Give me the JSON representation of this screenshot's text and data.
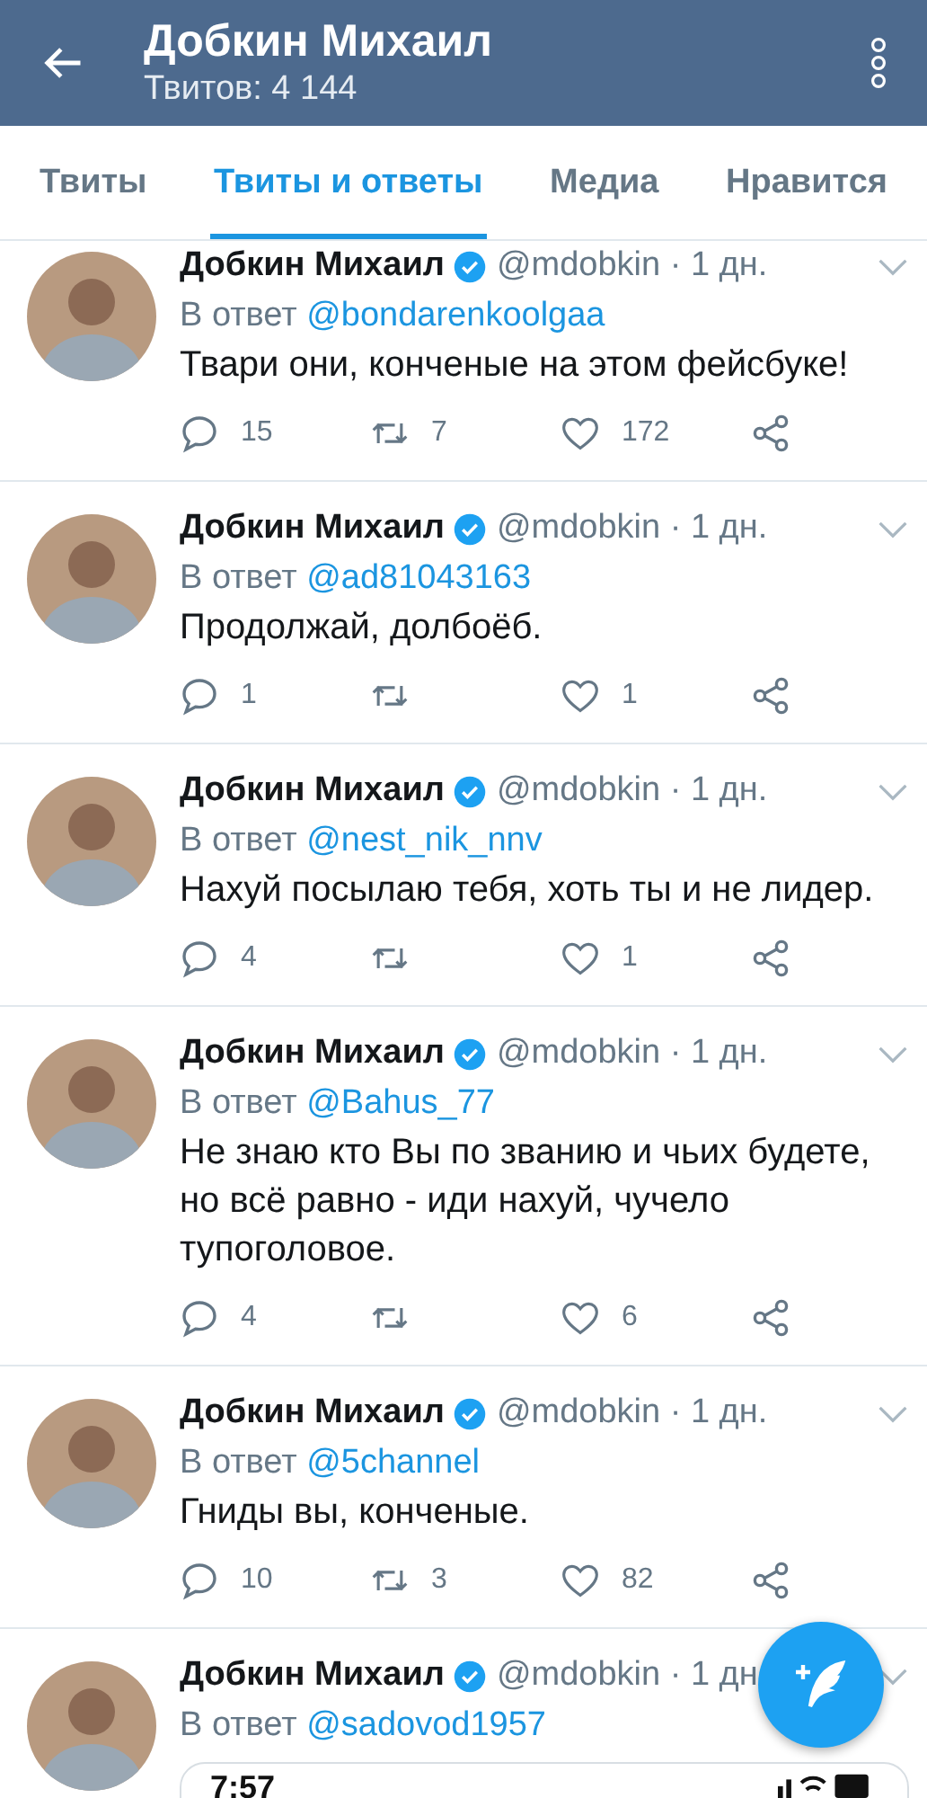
{
  "header": {
    "title": "Добкин Михаил",
    "subtitle": "Твитов: 4 144"
  },
  "tabs": [
    {
      "label": "Твиты",
      "selected": false
    },
    {
      "label": "Твиты и ответы",
      "selected": true
    },
    {
      "label": "Медиа",
      "selected": false
    },
    {
      "label": "Нравится",
      "selected": false
    }
  ],
  "tweets": [
    {
      "name": "Добкин Михаил",
      "verified": true,
      "handle": "@mdobkin · 1 дн.",
      "reply_prefix": "В ответ",
      "reply_to": "@bondarenkoolgaa",
      "text": "Твари они, конченые на этом фейсбуке!",
      "replies": "15",
      "retweets": "7",
      "likes": "172"
    },
    {
      "name": "Добкин Михаил",
      "verified": true,
      "handle": "@mdobkin · 1 дн.",
      "reply_prefix": "В ответ",
      "reply_to": "@ad81043163",
      "text": "Продолжай, долбоёб.",
      "replies": "1",
      "likes": "1"
    },
    {
      "name": "Добкин Михаил",
      "verified": true,
      "handle": "@mdobkin · 1 дн.",
      "reply_prefix": "В ответ",
      "reply_to": "@nest_nik_nnv",
      "text": "Нахуй посылаю тебя, хоть ты и не лидер.",
      "replies": "4",
      "likes": "1"
    },
    {
      "name": "Добкин Михаил",
      "verified": true,
      "handle": "@mdobkin · 1 дн.",
      "reply_prefix": "В ответ",
      "reply_to": "@Bahus_77",
      "text": "Не знаю кто Вы по званию и чьих будете, но всё равно - иди нахуй, чучело тупоголовое.",
      "replies": "4",
      "likes": "6"
    },
    {
      "name": "Добкин Михаил",
      "verified": true,
      "handle": "@mdobkin · 1 дн.",
      "reply_prefix": "В ответ",
      "reply_to": "@5channel",
      "text": "Гниды вы, конченые.",
      "replies": "10",
      "retweets": "3",
      "likes": "82"
    },
    {
      "name": "Добкин Михаил",
      "verified": true,
      "handle": "@mdobkin · 1 дн",
      "reply_prefix": "В ответ",
      "reply_to": "@sadovod1957",
      "embed": {
        "time": "7:57"
      }
    }
  ]
}
